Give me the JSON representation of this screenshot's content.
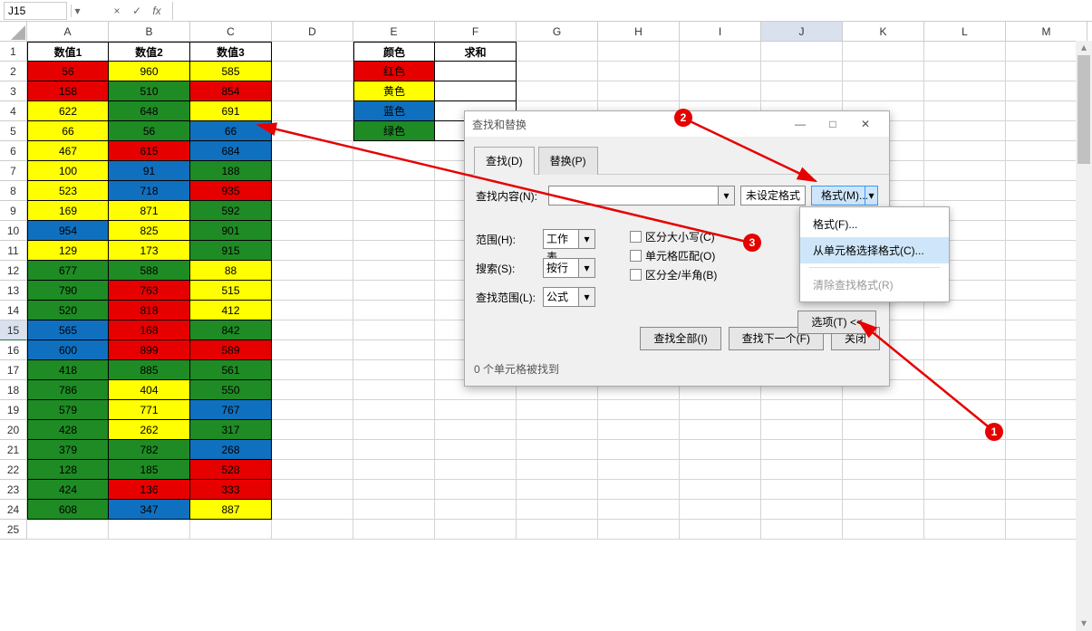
{
  "formula_bar": {
    "name_box": "J15",
    "cancel": "×",
    "confirm": "✓",
    "fx": "fx"
  },
  "col_headers": [
    "A",
    "B",
    "C",
    "D",
    "E",
    "F",
    "G",
    "H",
    "I",
    "J",
    "K",
    "L",
    "M"
  ],
  "row_headers": [
    1,
    2,
    3,
    4,
    5,
    6,
    7,
    8,
    9,
    10,
    11,
    12,
    13,
    14,
    15,
    16,
    17,
    18,
    19,
    20,
    21,
    22,
    23,
    24,
    25
  ],
  "selected_cell": "J15",
  "table1_headers": [
    "数值1",
    "数值2",
    "数值3"
  ],
  "table1": [
    [
      {
        "v": 56,
        "c": "red"
      },
      {
        "v": 960,
        "c": "yellow"
      },
      {
        "v": 585,
        "c": "yellow"
      }
    ],
    [
      {
        "v": 158,
        "c": "red"
      },
      {
        "v": 510,
        "c": "green"
      },
      {
        "v": 854,
        "c": "red"
      }
    ],
    [
      {
        "v": 622,
        "c": "yellow"
      },
      {
        "v": 648,
        "c": "green"
      },
      {
        "v": 691,
        "c": "yellow"
      }
    ],
    [
      {
        "v": 66,
        "c": "yellow"
      },
      {
        "v": 56,
        "c": "green"
      },
      {
        "v": 66,
        "c": "blue"
      }
    ],
    [
      {
        "v": 467,
        "c": "yellow"
      },
      {
        "v": 615,
        "c": "red"
      },
      {
        "v": 684,
        "c": "blue"
      }
    ],
    [
      {
        "v": 100,
        "c": "yellow"
      },
      {
        "v": 91,
        "c": "blue"
      },
      {
        "v": 188,
        "c": "green"
      }
    ],
    [
      {
        "v": 523,
        "c": "yellow"
      },
      {
        "v": 718,
        "c": "blue"
      },
      {
        "v": 935,
        "c": "red"
      }
    ],
    [
      {
        "v": 169,
        "c": "yellow"
      },
      {
        "v": 871,
        "c": "yellow"
      },
      {
        "v": 592,
        "c": "green"
      }
    ],
    [
      {
        "v": 954,
        "c": "blue"
      },
      {
        "v": 825,
        "c": "yellow"
      },
      {
        "v": 901,
        "c": "green"
      }
    ],
    [
      {
        "v": 129,
        "c": "yellow"
      },
      {
        "v": 173,
        "c": "yellow"
      },
      {
        "v": 915,
        "c": "green"
      }
    ],
    [
      {
        "v": 677,
        "c": "green"
      },
      {
        "v": 588,
        "c": "green"
      },
      {
        "v": 88,
        "c": "yellow"
      }
    ],
    [
      {
        "v": 790,
        "c": "green"
      },
      {
        "v": 763,
        "c": "red"
      },
      {
        "v": 515,
        "c": "yellow"
      }
    ],
    [
      {
        "v": 520,
        "c": "green"
      },
      {
        "v": 818,
        "c": "red"
      },
      {
        "v": 412,
        "c": "yellow"
      }
    ],
    [
      {
        "v": 565,
        "c": "blue"
      },
      {
        "v": 168,
        "c": "red"
      },
      {
        "v": 842,
        "c": "green"
      }
    ],
    [
      {
        "v": 600,
        "c": "blue"
      },
      {
        "v": 899,
        "c": "red"
      },
      {
        "v": 589,
        "c": "red"
      }
    ],
    [
      {
        "v": 418,
        "c": "green"
      },
      {
        "v": 885,
        "c": "green"
      },
      {
        "v": 561,
        "c": "green"
      }
    ],
    [
      {
        "v": 786,
        "c": "green"
      },
      {
        "v": 404,
        "c": "yellow"
      },
      {
        "v": 550,
        "c": "green"
      }
    ],
    [
      {
        "v": 579,
        "c": "green"
      },
      {
        "v": 771,
        "c": "yellow"
      },
      {
        "v": 767,
        "c": "blue"
      }
    ],
    [
      {
        "v": 428,
        "c": "green"
      },
      {
        "v": 262,
        "c": "yellow"
      },
      {
        "v": 317,
        "c": "green"
      }
    ],
    [
      {
        "v": 379,
        "c": "green"
      },
      {
        "v": 782,
        "c": "green"
      },
      {
        "v": 268,
        "c": "blue"
      }
    ],
    [
      {
        "v": 128,
        "c": "green"
      },
      {
        "v": 185,
        "c": "green"
      },
      {
        "v": 528,
        "c": "red"
      }
    ],
    [
      {
        "v": 424,
        "c": "green"
      },
      {
        "v": 136,
        "c": "red"
      },
      {
        "v": 333,
        "c": "red"
      }
    ],
    [
      {
        "v": 608,
        "c": "green"
      },
      {
        "v": 347,
        "c": "blue"
      },
      {
        "v": 887,
        "c": "yellow"
      }
    ]
  ],
  "table2_headers": [
    "颜色",
    "求和"
  ],
  "table2_rows": [
    {
      "label": "红色",
      "c": "red"
    },
    {
      "label": "黄色",
      "c": "yellow"
    },
    {
      "label": "蓝色",
      "c": "blue"
    },
    {
      "label": "绿色",
      "c": "green"
    }
  ],
  "dialog": {
    "title": "查找和替换",
    "tabs": {
      "find": "查找(D)",
      "replace": "替换(P)"
    },
    "find_what_label": "查找内容(N):",
    "format_preview": "未设定格式",
    "format_button": "格式(M)...",
    "options_label": "选项(T) <<",
    "scope_label": "范围(H):",
    "scope_value": "工作表",
    "search_label": "搜索(S):",
    "search_value": "按行",
    "lookin_label": "查找范围(L):",
    "lookin_value": "公式",
    "chk_case": "区分大小写(C)",
    "chk_whole": "单元格匹配(O)",
    "chk_width": "区分全/半角(B)",
    "btn_findall": "查找全部(I)",
    "btn_findnext": "查找下一个(F)",
    "btn_close": "关闭",
    "status": "0 个单元格被找到"
  },
  "format_menu": {
    "item_format": "格式(F)...",
    "item_fromcell": "从单元格选择格式(C)...",
    "item_clear": "清除查找格式(R)"
  },
  "annotations": {
    "a1": "1",
    "a2": "2",
    "a3": "3"
  }
}
